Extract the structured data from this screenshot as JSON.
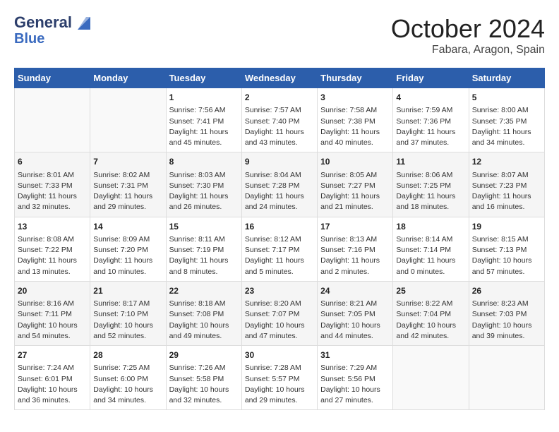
{
  "logo": {
    "line1": "General",
    "line2": "Blue"
  },
  "title": "October 2024",
  "location": "Fabara, Aragon, Spain",
  "days_of_week": [
    "Sunday",
    "Monday",
    "Tuesday",
    "Wednesday",
    "Thursday",
    "Friday",
    "Saturday"
  ],
  "weeks": [
    [
      {
        "day": "",
        "info": ""
      },
      {
        "day": "",
        "info": ""
      },
      {
        "day": "1",
        "info": "Sunrise: 7:56 AM\nSunset: 7:41 PM\nDaylight: 11 hours and 45 minutes."
      },
      {
        "day": "2",
        "info": "Sunrise: 7:57 AM\nSunset: 7:40 PM\nDaylight: 11 hours and 43 minutes."
      },
      {
        "day": "3",
        "info": "Sunrise: 7:58 AM\nSunset: 7:38 PM\nDaylight: 11 hours and 40 minutes."
      },
      {
        "day": "4",
        "info": "Sunrise: 7:59 AM\nSunset: 7:36 PM\nDaylight: 11 hours and 37 minutes."
      },
      {
        "day": "5",
        "info": "Sunrise: 8:00 AM\nSunset: 7:35 PM\nDaylight: 11 hours and 34 minutes."
      }
    ],
    [
      {
        "day": "6",
        "info": "Sunrise: 8:01 AM\nSunset: 7:33 PM\nDaylight: 11 hours and 32 minutes."
      },
      {
        "day": "7",
        "info": "Sunrise: 8:02 AM\nSunset: 7:31 PM\nDaylight: 11 hours and 29 minutes."
      },
      {
        "day": "8",
        "info": "Sunrise: 8:03 AM\nSunset: 7:30 PM\nDaylight: 11 hours and 26 minutes."
      },
      {
        "day": "9",
        "info": "Sunrise: 8:04 AM\nSunset: 7:28 PM\nDaylight: 11 hours and 24 minutes."
      },
      {
        "day": "10",
        "info": "Sunrise: 8:05 AM\nSunset: 7:27 PM\nDaylight: 11 hours and 21 minutes."
      },
      {
        "day": "11",
        "info": "Sunrise: 8:06 AM\nSunset: 7:25 PM\nDaylight: 11 hours and 18 minutes."
      },
      {
        "day": "12",
        "info": "Sunrise: 8:07 AM\nSunset: 7:23 PM\nDaylight: 11 hours and 16 minutes."
      }
    ],
    [
      {
        "day": "13",
        "info": "Sunrise: 8:08 AM\nSunset: 7:22 PM\nDaylight: 11 hours and 13 minutes."
      },
      {
        "day": "14",
        "info": "Sunrise: 8:09 AM\nSunset: 7:20 PM\nDaylight: 11 hours and 10 minutes."
      },
      {
        "day": "15",
        "info": "Sunrise: 8:11 AM\nSunset: 7:19 PM\nDaylight: 11 hours and 8 minutes."
      },
      {
        "day": "16",
        "info": "Sunrise: 8:12 AM\nSunset: 7:17 PM\nDaylight: 11 hours and 5 minutes."
      },
      {
        "day": "17",
        "info": "Sunrise: 8:13 AM\nSunset: 7:16 PM\nDaylight: 11 hours and 2 minutes."
      },
      {
        "day": "18",
        "info": "Sunrise: 8:14 AM\nSunset: 7:14 PM\nDaylight: 11 hours and 0 minutes."
      },
      {
        "day": "19",
        "info": "Sunrise: 8:15 AM\nSunset: 7:13 PM\nDaylight: 10 hours and 57 minutes."
      }
    ],
    [
      {
        "day": "20",
        "info": "Sunrise: 8:16 AM\nSunset: 7:11 PM\nDaylight: 10 hours and 54 minutes."
      },
      {
        "day": "21",
        "info": "Sunrise: 8:17 AM\nSunset: 7:10 PM\nDaylight: 10 hours and 52 minutes."
      },
      {
        "day": "22",
        "info": "Sunrise: 8:18 AM\nSunset: 7:08 PM\nDaylight: 10 hours and 49 minutes."
      },
      {
        "day": "23",
        "info": "Sunrise: 8:20 AM\nSunset: 7:07 PM\nDaylight: 10 hours and 47 minutes."
      },
      {
        "day": "24",
        "info": "Sunrise: 8:21 AM\nSunset: 7:05 PM\nDaylight: 10 hours and 44 minutes."
      },
      {
        "day": "25",
        "info": "Sunrise: 8:22 AM\nSunset: 7:04 PM\nDaylight: 10 hours and 42 minutes."
      },
      {
        "day": "26",
        "info": "Sunrise: 8:23 AM\nSunset: 7:03 PM\nDaylight: 10 hours and 39 minutes."
      }
    ],
    [
      {
        "day": "27",
        "info": "Sunrise: 7:24 AM\nSunset: 6:01 PM\nDaylight: 10 hours and 36 minutes."
      },
      {
        "day": "28",
        "info": "Sunrise: 7:25 AM\nSunset: 6:00 PM\nDaylight: 10 hours and 34 minutes."
      },
      {
        "day": "29",
        "info": "Sunrise: 7:26 AM\nSunset: 5:58 PM\nDaylight: 10 hours and 32 minutes."
      },
      {
        "day": "30",
        "info": "Sunrise: 7:28 AM\nSunset: 5:57 PM\nDaylight: 10 hours and 29 minutes."
      },
      {
        "day": "31",
        "info": "Sunrise: 7:29 AM\nSunset: 5:56 PM\nDaylight: 10 hours and 27 minutes."
      },
      {
        "day": "",
        "info": ""
      },
      {
        "day": "",
        "info": ""
      }
    ]
  ]
}
